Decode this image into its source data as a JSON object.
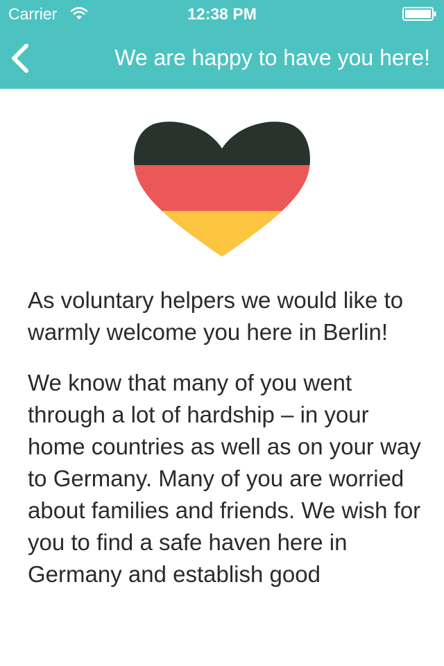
{
  "status_bar": {
    "carrier": "Carrier",
    "time": "12:38 PM",
    "wifi_icon": "wifi-icon",
    "battery_icon": "battery-icon"
  },
  "nav_bar": {
    "back_icon": "chevron-left-icon",
    "title": "We are happy to have you here!"
  },
  "hero": {
    "icon": "german-flag-heart-icon",
    "colors": [
      "#29332e",
      "#ec5757",
      "#fcc43f"
    ]
  },
  "body": {
    "paragraphs": [
      "As voluntary helpers we would like to warmly welcome you here in Berlin!",
      "We know that many of you went through a lot of hardship – in your home countries as well as on your way to Germany. Many of you are worried about families and friends. We wish for you to find a safe haven here in Germany and establish good"
    ]
  },
  "colors": {
    "header_background": "#4cc3c1",
    "header_text": "#ffffff",
    "body_text": "#2a2a2a",
    "background": "#ffffff"
  }
}
